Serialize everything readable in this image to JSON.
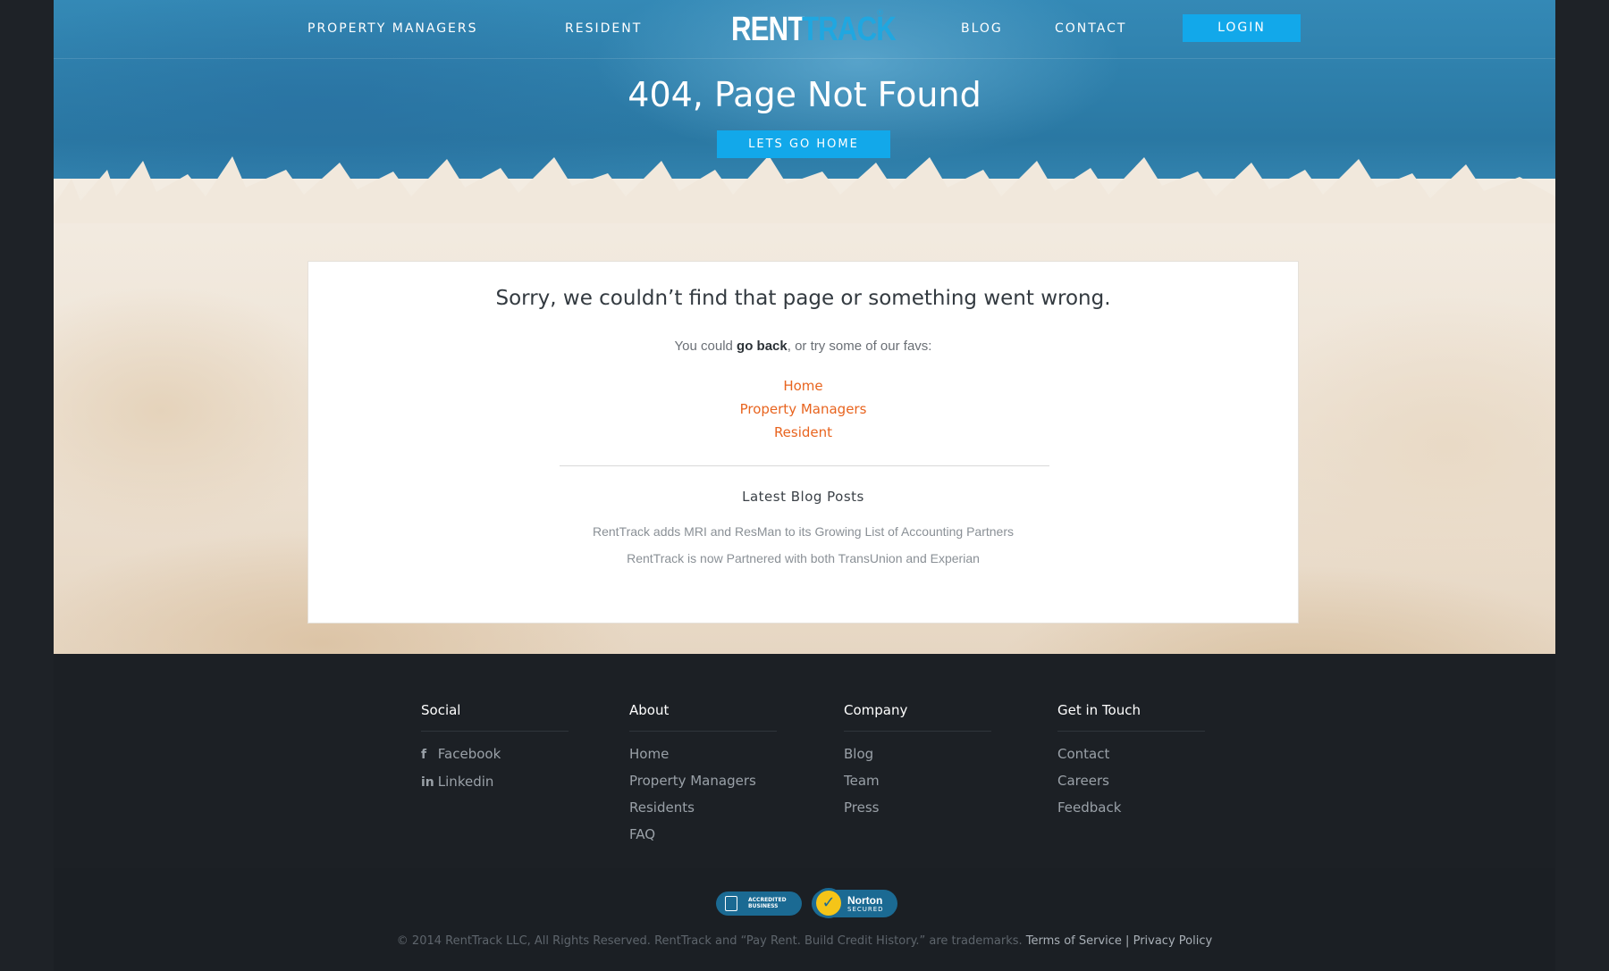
{
  "nav": {
    "items": [
      "PROPERTY MANAGERS",
      "RESIDENT",
      "BLOG",
      "CONTACT"
    ],
    "logo_part1": "RENT",
    "logo_part2": "TRACK",
    "logo_reg": "®",
    "login": "LOGIN"
  },
  "hero": {
    "title": "404, Page Not Found",
    "button": "LETS GO HOME"
  },
  "card": {
    "heading": "Sorry, we couldn’t find that page or something went wrong.",
    "intro_before": "You could ",
    "intro_link": "go back",
    "intro_after": ", or try some of our favs:",
    "favs": [
      "Home",
      "Property Managers",
      "Resident"
    ],
    "blog_title": "Latest Blog Posts",
    "posts": [
      "RentTrack adds MRI and ResMan to its Growing List of Accounting Partners",
      "RentTrack is now Partnered with both TransUnion and Experian"
    ]
  },
  "footer": {
    "social": {
      "title": "Social",
      "links": [
        "Facebook",
        "Linkedin"
      ]
    },
    "about": {
      "title": "About",
      "links": [
        "Home",
        "Property Managers",
        "Residents",
        "FAQ"
      ]
    },
    "company": {
      "title": "Company",
      "links": [
        "Blog",
        "Team",
        "Press"
      ]
    },
    "contact": {
      "title": "Get in Touch",
      "links": [
        "Contact",
        "Careers",
        "Feedback"
      ]
    },
    "badges": {
      "bbb_line1": "ACCREDITED",
      "bbb_line2": "BUSINESS",
      "norton_line1": "Norton",
      "norton_line2": "SECURED"
    },
    "copyright": "© 2014 RentTrack LLC, All Rights Reserved. RentTrack and “Pay Rent. Build Credit History.” are trademarks.",
    "terms": "Terms of Service",
    "separator": "|",
    "privacy": "Privacy Policy"
  },
  "colors": {
    "accent_blue": "#12a8ea",
    "link_orange": "#e8641f",
    "footer_bg": "#1c2025"
  }
}
